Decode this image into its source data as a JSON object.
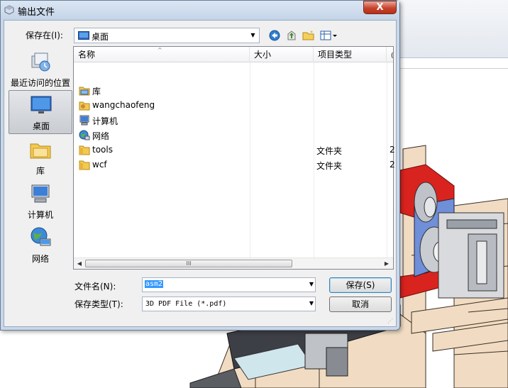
{
  "dialog": {
    "title": "输出文件",
    "close_glyph": "X",
    "save_in_label": "保存在(I):",
    "location": "桌面",
    "places": [
      {
        "label": "最近访问的位置",
        "icon": "recent-places-icon"
      },
      {
        "label": "桌面",
        "icon": "desktop-icon"
      },
      {
        "label": "库",
        "icon": "libraries-icon"
      },
      {
        "label": "计算机",
        "icon": "computer-icon"
      },
      {
        "label": "网络",
        "icon": "network-icon"
      }
    ],
    "columns": {
      "name": "名称",
      "size": "大小",
      "type": "项目类型",
      "extra": "("
    },
    "files": [
      {
        "name": "库",
        "type": "",
        "extra": "",
        "icon": "library-icon"
      },
      {
        "name": "wangchaofeng",
        "type": "",
        "extra": "",
        "icon": "user-folder-icon"
      },
      {
        "name": "计算机",
        "type": "",
        "extra": "",
        "icon": "computer-icon"
      },
      {
        "name": "网络",
        "type": "",
        "extra": "",
        "icon": "network-icon"
      },
      {
        "name": "tools",
        "type": "文件夹",
        "extra": "2",
        "icon": "folder-icon"
      },
      {
        "name": "wcf",
        "type": "文件夹",
        "extra": "2",
        "icon": "folder-icon"
      }
    ],
    "scroll_grip": "III",
    "filename_label": "文件名(N):",
    "filename_value": "asm2",
    "filetype_label": "保存类型(T):",
    "filetype_value": "3D PDF File (*.pdf)",
    "save_button": "保存(S)",
    "cancel_button": "取消"
  },
  "colors": {
    "title_gradient_top": "#dbe6f3",
    "selection_blue": "#3399ff",
    "close_red": "#c8432c"
  }
}
